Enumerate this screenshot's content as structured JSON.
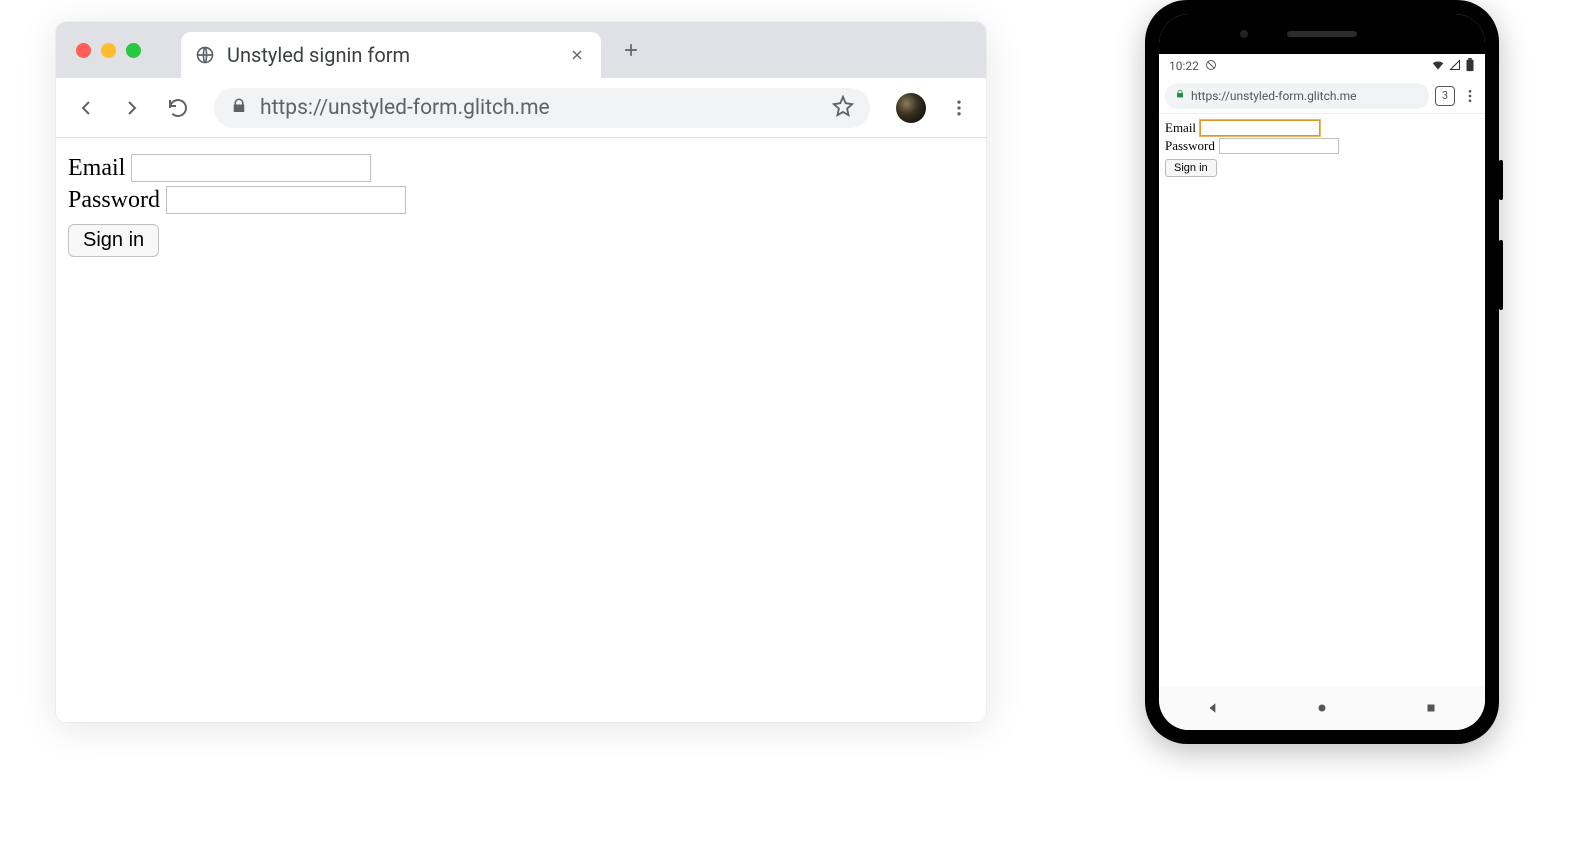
{
  "desktop": {
    "tab": {
      "title": "Unstyled signin form"
    },
    "url": "https://unstyled-form.glitch.me",
    "form": {
      "email_label": "Email",
      "password_label": "Password",
      "signin_label": "Sign in"
    }
  },
  "phone": {
    "status_time": "10:22",
    "url": "https://unstyled-form.glitch.me",
    "tab_count": "3",
    "form": {
      "email_label": "Email",
      "password_label": "Password",
      "signin_label": "Sign in"
    }
  }
}
